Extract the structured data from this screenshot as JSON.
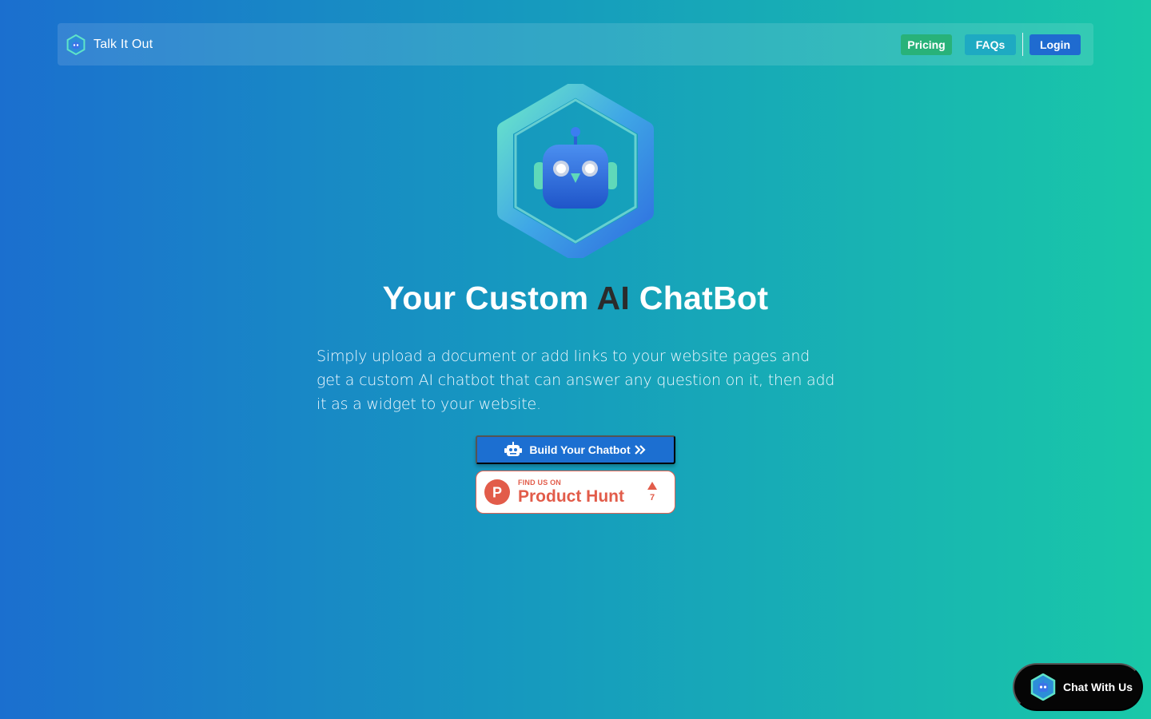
{
  "header": {
    "brand_name": "Talk It Out",
    "logo_icon": "robot-hexagon-logo-icon",
    "nav": {
      "pricing": "Pricing",
      "faqs": "FAQs",
      "login": "Login"
    }
  },
  "hero": {
    "title_part1": "Your Custom ",
    "title_accent": "AI",
    "title_part2": " ChatBot",
    "description": "Simply upload a document or add links to your website pages and get a custom AI chatbot that can answer any question on it, then add it as a widget to your website.",
    "cta_label": "Build Your Chatbot"
  },
  "product_hunt": {
    "small_text": "FIND US ON",
    "big_text": "Product Hunt",
    "letter": "P",
    "votes": "7"
  },
  "chat_widget": {
    "label": "Chat With Us"
  },
  "colors": {
    "gradient_start": "#1b6fcf",
    "gradient_end": "#19c8a8",
    "pricing_bg": "#28b279",
    "faqs_bg": "#1eaac2",
    "login_bg": "#1f6bd0",
    "cta_bg": "#1c6fd1",
    "product_hunt": "#e25c4a"
  }
}
